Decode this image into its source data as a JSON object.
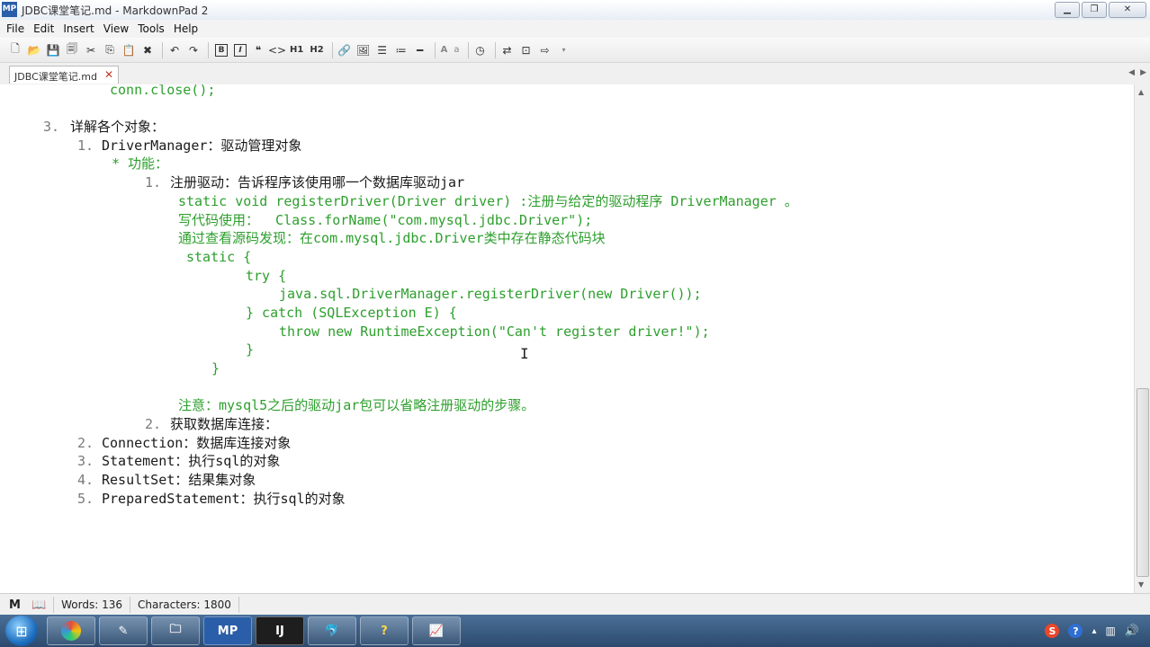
{
  "window": {
    "title": "JDBC课堂笔记.md - MarkdownPad 2",
    "app_icon": "MP",
    "min": "▁",
    "max": "❐",
    "close": "✕"
  },
  "menu": [
    "File",
    "Edit",
    "Insert",
    "View",
    "Tools",
    "Help"
  ],
  "toolbar": {
    "h1": "H1",
    "h2": "H2",
    "bold": "B",
    "italic": "I",
    "font_big": "A",
    "font_small": "a"
  },
  "tab": {
    "label": "JDBC课堂笔记.md",
    "close": "✕"
  },
  "editor": {
    "lines": [
      {
        "n": "",
        "text": "conn.close();",
        "c": "g"
      },
      {
        "n": "3.",
        "text": "详解各个对象：",
        "c": "b"
      },
      {
        "n": "1.",
        "text": "DriverManager：驱动管理对象",
        "c": "b"
      },
      {
        "n": "",
        "text": "* 功能：",
        "c": "g"
      },
      {
        "n": "1.",
        "text": "注册驱动：告诉程序该使用哪一个数据库驱动jar",
        "c": "b"
      },
      {
        "n": "",
        "text": "static void registerDriver(Driver driver) :注册与给定的驱动程序 DriverManager 。",
        "c": "g"
      },
      {
        "n": "",
        "text": "写代码使用：  Class.forName(\"com.mysql.jdbc.Driver\");",
        "c": "g"
      },
      {
        "n": "",
        "text": "通过查看源码发现：在com.mysql.jdbc.Driver类中存在静态代码块",
        "c": "g"
      },
      {
        "n": "",
        "text": "static {",
        "c": "g"
      },
      {
        "n": "",
        "text": "try {",
        "c": "g"
      },
      {
        "n": "",
        "text": "java.sql.DriverManager.registerDriver(new Driver());",
        "c": "g"
      },
      {
        "n": "",
        "text": "} catch (SQLException E) {",
        "c": "g"
      },
      {
        "n": "",
        "text": "throw new RuntimeException(\"Can't register driver!\");",
        "c": "g"
      },
      {
        "n": "",
        "text": "}",
        "c": "g"
      },
      {
        "n": "",
        "text": "}",
        "c": "g"
      },
      {
        "n": "",
        "text": "注意：mysql5之后的驱动jar包可以省略注册驱动的步骤。",
        "c": "g"
      },
      {
        "n": "2.",
        "text": "获取数据库连接：",
        "c": "b"
      },
      {
        "n": "2.",
        "text": "Connection：数据库连接对象",
        "c": "b"
      },
      {
        "n": "3.",
        "text": "Statement：执行sql的对象",
        "c": "b"
      },
      {
        "n": "4.",
        "text": "ResultSet：结果集对象",
        "c": "b"
      },
      {
        "n": "5.",
        "text": "PreparedStatement：执行sql的对象",
        "c": "b"
      }
    ]
  },
  "status": {
    "words": "Words: 136",
    "characters": "Characters: 1800",
    "md_icon": "M",
    "book_icon": "📖"
  },
  "taskbar": {
    "start": "⊞",
    "items": [
      "",
      "",
      "",
      "MP",
      "IJ",
      "",
      "?",
      ""
    ]
  },
  "tray": {
    "s": "S",
    "help": "?",
    "sound": "🔊"
  },
  "colors": {
    "code_green": "#2d9f2d",
    "text_dark": "#1a1a1a",
    "list_number": "#7a7a7a"
  }
}
